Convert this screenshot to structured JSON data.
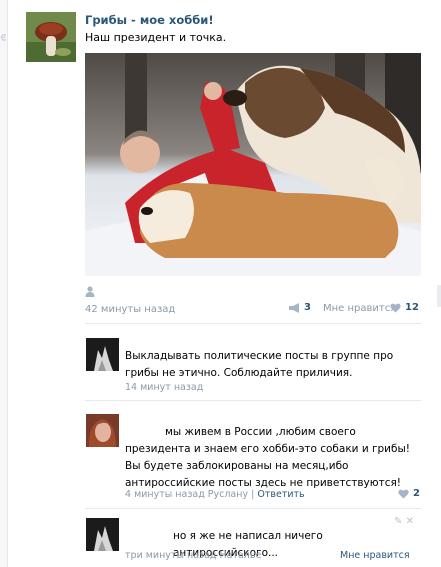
{
  "post": {
    "group_name": "Грибы - мое хобби!",
    "text": "Наш президент и точка.",
    "time": "42 минуты назад",
    "share_count": "3",
    "like_label": "Мне нравится",
    "like_count": "12"
  },
  "comments": [
    {
      "text": "Выкладывать политические посты в группе про грибы не этично. Соблюдайте приличия.",
      "time": "14 минут назад"
    },
    {
      "text": "мы живем в России ,любим своего президента и знаем его хобби-это собаки и грибы! Вы будете заблокированы на месяц,ибо антироссийские посты здесь не приветствуются!",
      "time": "4 минуты назад Руслану",
      "reply_link": "Ответить",
      "separator": "|",
      "like_count": "2"
    },
    {
      "text": "но я же не написал ничего антироссийского...",
      "time": "три минуты назад Наталье",
      "like_label": "Мне нравится"
    }
  ],
  "colors": {
    "link_blue": "#2b587a",
    "meta_gray": "#8a9aa9"
  }
}
